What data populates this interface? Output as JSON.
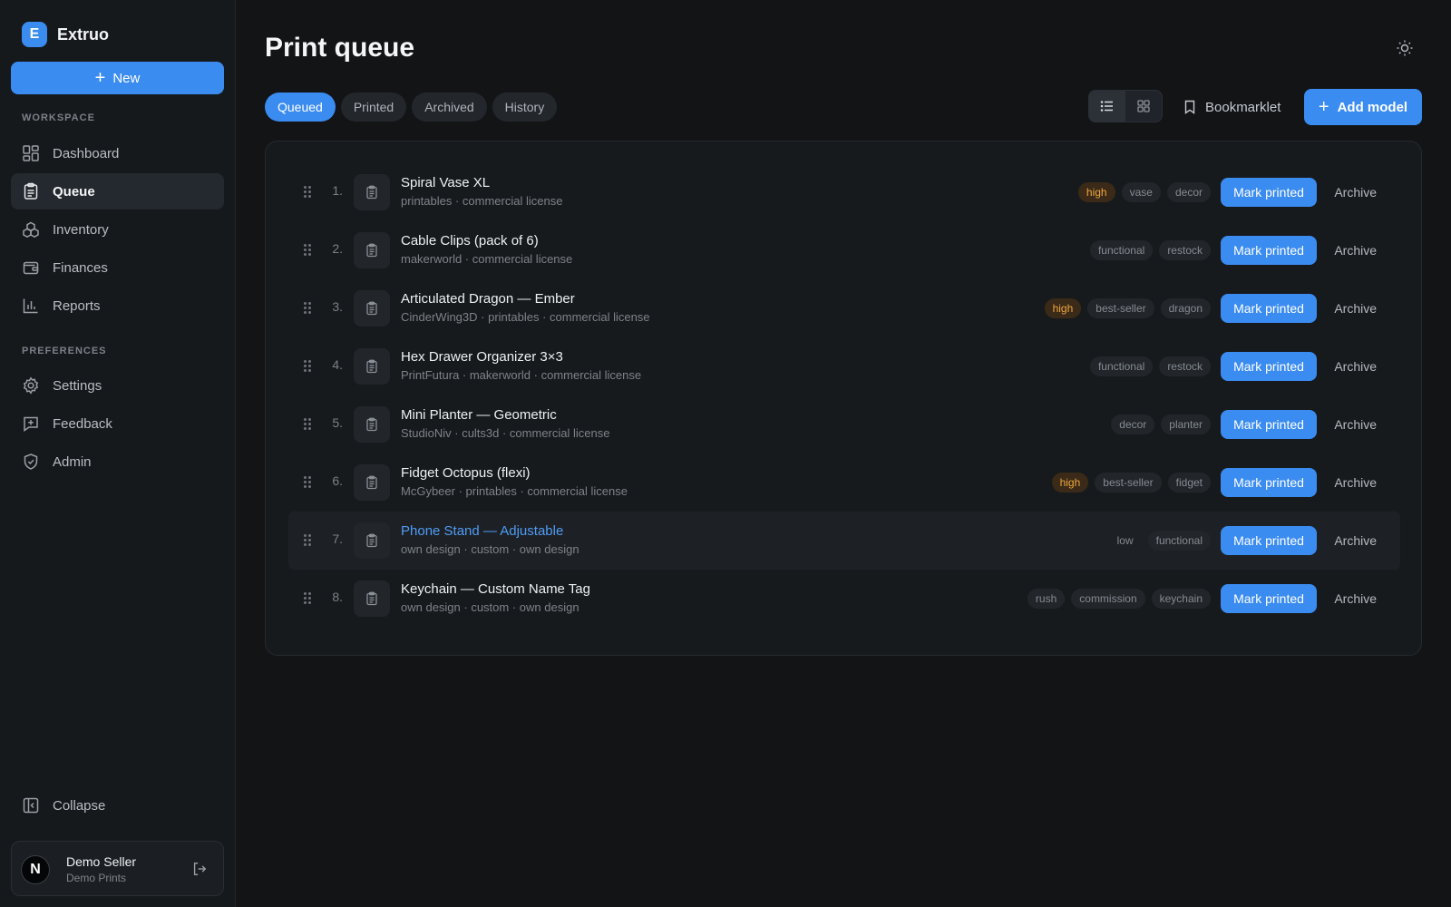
{
  "app": {
    "logo_letter": "E",
    "name": "Extruo"
  },
  "sidebar": {
    "new_label": "New",
    "workspace_label": "WORKSPACE",
    "workspace_items": [
      {
        "label": "Dashboard",
        "icon": "dashboard-icon"
      },
      {
        "label": "Queue",
        "icon": "clipboard-icon",
        "active": true
      },
      {
        "label": "Inventory",
        "icon": "boxes-icon"
      },
      {
        "label": "Finances",
        "icon": "wallet-icon"
      },
      {
        "label": "Reports",
        "icon": "bar-chart-icon"
      }
    ],
    "preferences_label": "PREFERENCES",
    "preference_items": [
      {
        "label": "Settings",
        "icon": "gear-icon"
      },
      {
        "label": "Feedback",
        "icon": "message-plus-icon"
      },
      {
        "label": "Admin",
        "icon": "shield-icon"
      }
    ],
    "collapse_label": "Collapse",
    "user": {
      "avatar_letter": "N",
      "name": "Demo Seller",
      "org": "Demo Prints"
    }
  },
  "header": {
    "title": "Print queue"
  },
  "tabs": [
    {
      "label": "Queued",
      "active": true
    },
    {
      "label": "Printed"
    },
    {
      "label": "Archived"
    },
    {
      "label": "History"
    }
  ],
  "toolbar": {
    "bookmarklet_label": "Bookmarklet",
    "add_model_label": "Add model"
  },
  "queue": [
    {
      "num": "1.",
      "title": "Spiral Vase XL",
      "meta": "printables · commercial license",
      "tags": [
        "high",
        "vase",
        "decor"
      ]
    },
    {
      "num": "2.",
      "title": "Cable Clips (pack of 6)",
      "meta": "makerworld · commercial license",
      "tags": [
        "functional",
        "restock"
      ]
    },
    {
      "num": "3.",
      "title": "Articulated Dragon — Ember",
      "meta": "CinderWing3D · printables · commercial license",
      "tags": [
        "high",
        "best-seller",
        "dragon"
      ]
    },
    {
      "num": "4.",
      "title": "Hex Drawer Organizer 3×3",
      "meta": "PrintFutura · makerworld · commercial license",
      "tags": [
        "functional",
        "restock"
      ]
    },
    {
      "num": "5.",
      "title": "Mini Planter — Geometric",
      "meta": "StudioNiv · cults3d · commercial license",
      "tags": [
        "decor",
        "planter"
      ]
    },
    {
      "num": "6.",
      "title": "Fidget Octopus (flexi)",
      "meta": "McGybeer · printables · commercial license",
      "tags": [
        "high",
        "best-seller",
        "fidget"
      ]
    },
    {
      "num": "7.",
      "title": "Phone Stand — Adjustable",
      "meta": "own design · custom · own design",
      "tags": [
        "low",
        "functional"
      ],
      "hover": true
    },
    {
      "num": "8.",
      "title": "Keychain — Custom Name Tag",
      "meta": "own design · custom · own design",
      "tags": [
        "rush",
        "commission",
        "keychain"
      ]
    }
  ],
  "row_actions": {
    "mark_label": "Mark printed",
    "archive_label": "Archive"
  },
  "colors": {
    "accent": "#3b8cf0",
    "high_tag": "#f0a640",
    "background": "#121416"
  }
}
